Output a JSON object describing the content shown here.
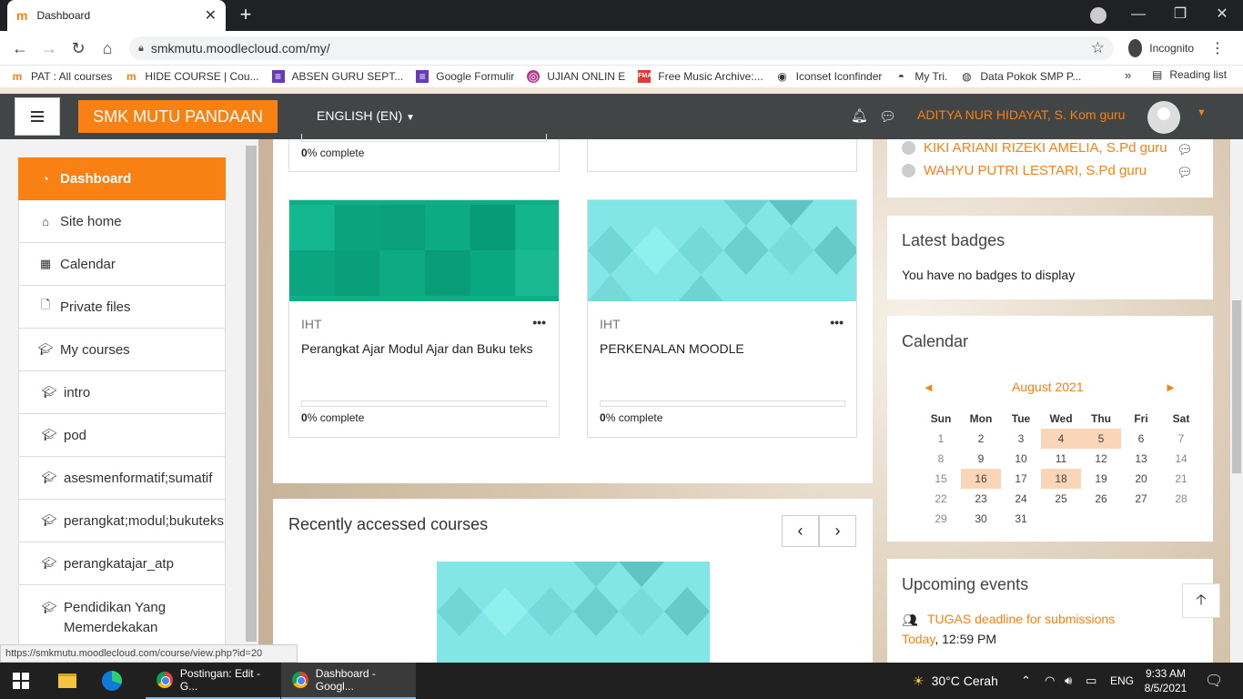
{
  "browser": {
    "tab_title": "Dashboard",
    "url": "smkmutu.moodlecloud.com/my/",
    "incognito_label": "Incognito",
    "bookmarks": [
      "PAT : All courses",
      "HIDE COURSE | Cou...",
      "ABSEN GURU SEPT...",
      "Google Formulir",
      "UJIAN ONLIN E",
      "Free Music Archive:...",
      "Iconset Iconfinder",
      "My Tri.",
      "Data Pokok SMP P..."
    ],
    "reading_list": "Reading list",
    "status_url": "https://smkmutu.moodlecloud.com/course/view.php?id=20"
  },
  "navbar": {
    "brand": "SMK MUTU PANDAAN",
    "language": "ENGLISH (EN)",
    "user_name": "ADITYA NUR HIDAYAT, S. Kom guru"
  },
  "drawer": {
    "items": [
      {
        "label": "Dashboard",
        "icon": "dashboard-icon"
      },
      {
        "label": "Site home",
        "icon": "home-icon"
      },
      {
        "label": "Calendar",
        "icon": "calendar-icon"
      },
      {
        "label": "Private files",
        "icon": "file-icon"
      },
      {
        "label": "My courses",
        "icon": "graduation-cap-icon"
      },
      {
        "label": "intro",
        "icon": "graduation-cap-icon"
      },
      {
        "label": "pod",
        "icon": "graduation-cap-icon"
      },
      {
        "label": "asesmenformatif;sumatif",
        "icon": "graduation-cap-icon"
      },
      {
        "label": "perangkat;modul;bukuteks",
        "icon": "graduation-cap-icon"
      },
      {
        "label": "perangkatajar_atp",
        "icon": "graduation-cap-icon"
      },
      {
        "label": "Pendidikan Yang Memerdekakan",
        "icon": "graduation-cap-icon"
      }
    ]
  },
  "courses": {
    "top_left_complete": {
      "pct": "0",
      "suffix": "% complete"
    },
    "cards": [
      {
        "category": "IHT",
        "title": "Perangkat Ajar Modul Ajar dan Buku teks",
        "pct": "0",
        "suffix": "% complete",
        "progress": 0
      },
      {
        "category": "IHT",
        "title": "PERKENALAN MOODLE",
        "pct": "0",
        "suffix": "% complete",
        "progress": 0
      }
    ],
    "recent_title": "Recently accessed courses"
  },
  "online_users": [
    "KIKI ARIANI RIZEKI AMELIA, S.Pd guru",
    "WAHYU PUTRI LESTARI, S.Pd guru"
  ],
  "badges": {
    "title": "Latest badges",
    "text": "You have no badges to display"
  },
  "calendar": {
    "title": "Calendar",
    "month": "August 2021",
    "days": [
      "Sun",
      "Mon",
      "Tue",
      "Wed",
      "Thu",
      "Fri",
      "Sat"
    ],
    "weeks": [
      [
        "1",
        "2",
        "3",
        "4",
        "5",
        "6",
        "7"
      ],
      [
        "8",
        "9",
        "10",
        "11",
        "12",
        "13",
        "14"
      ],
      [
        "15",
        "16",
        "17",
        "18",
        "19",
        "20",
        "21"
      ],
      [
        "22",
        "23",
        "24",
        "25",
        "26",
        "27",
        "28"
      ],
      [
        "29",
        "30",
        "31",
        "",
        "",
        "",
        ""
      ]
    ],
    "event_days": [
      "4",
      "5",
      "16",
      "18"
    ]
  },
  "upcoming": {
    "title": "Upcoming events",
    "event": "TUGAS deadline for submissions",
    "when_link": "Today",
    "when_time": ", 12:59 PM"
  },
  "taskbar": {
    "apps": [
      "Postingan: Edit - G...",
      "Dashboard - Googl..."
    ],
    "weather": "30°C  Cerah",
    "lang": "ENG",
    "time": "9:33 AM",
    "date": "8/5/2021"
  }
}
